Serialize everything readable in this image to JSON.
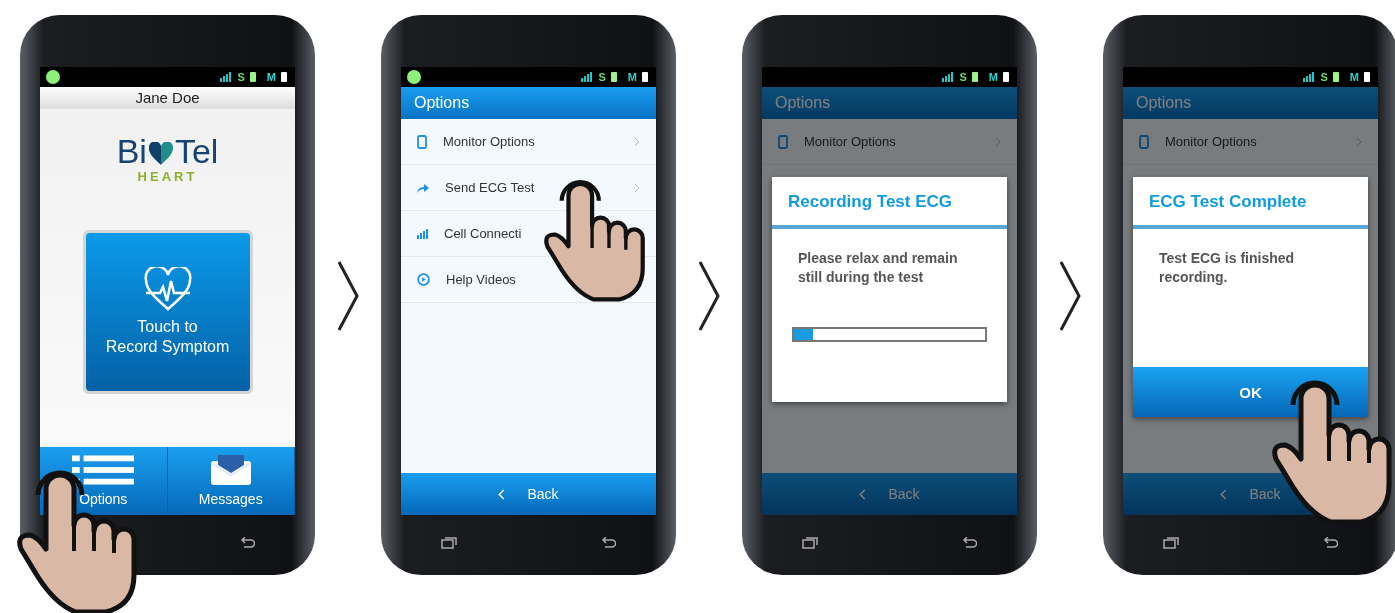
{
  "screens": [
    {
      "kind": "home",
      "touch_hand": true,
      "status": {
        "dot": true,
        "s": "S",
        "m": "M"
      },
      "user_name": "Jane Doe",
      "logo": {
        "left": "Bi",
        "right": "Tel",
        "sub": "HEART"
      },
      "record_button": {
        "line1": "Touch to",
        "line2": "Record Symptom"
      },
      "tab_bar": [
        {
          "label": "Options"
        },
        {
          "label": "Messages"
        }
      ]
    },
    {
      "kind": "options",
      "touch_hand": true,
      "status": {
        "dot": true,
        "s": "S",
        "m": "M"
      },
      "header": "Options",
      "items": [
        {
          "label": "Monitor Options"
        },
        {
          "label": "Send ECG Test"
        },
        {
          "label": "Cell Connecti"
        },
        {
          "label": "Help Videos"
        }
      ],
      "back": "Back"
    },
    {
      "kind": "dialog",
      "touch_hand": false,
      "status": {
        "dot": false,
        "s": "S",
        "m": "M"
      },
      "background": {
        "header": "Options",
        "items": [
          {
            "label": "Monitor Options"
          }
        ],
        "back": "Back"
      },
      "dialog": {
        "title": "Recording Test ECG",
        "message": "Please relax and remain still during the test",
        "progress": {
          "level": 0.1
        }
      }
    },
    {
      "kind": "dialog",
      "touch_hand": true,
      "status": {
        "dot": false,
        "s": "S",
        "m": "M"
      },
      "background": {
        "header": "Options",
        "items": [
          {
            "label": "Monitor Options"
          }
        ],
        "back": "Back"
      },
      "dialog": {
        "title": "ECG Test Complete",
        "message": "Test ECG is finished recording.",
        "button": "OK"
      }
    }
  ]
}
